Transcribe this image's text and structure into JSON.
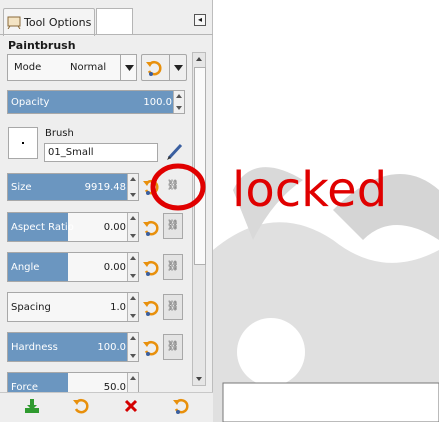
{
  "tab": {
    "label": "Tool Options"
  },
  "tool": {
    "title": "Paintbrush"
  },
  "mode": {
    "label": "Mode",
    "value": "Normal"
  },
  "opacity": {
    "label": "Opacity",
    "value": "100.0"
  },
  "brush": {
    "label": "Brush",
    "name": "01_Small"
  },
  "size": {
    "label": "Size",
    "value": "9919.48"
  },
  "aspect_ratio": {
    "label": "Aspect Ratio",
    "value": "0.00"
  },
  "angle": {
    "label": "Angle",
    "value": "0.00"
  },
  "spacing": {
    "label": "Spacing",
    "value": "1.0"
  },
  "hardness": {
    "label": "Hardness",
    "value": "100.0"
  },
  "force": {
    "label": "Force",
    "value": "50.0"
  },
  "annotation": {
    "text": "locked",
    "color": "#e00000"
  },
  "colors": {
    "slider_fill": "#6b96c0",
    "reset_orange": "#e8900c",
    "delete_red": "#d40000",
    "save_green": "#2f9a2f"
  }
}
